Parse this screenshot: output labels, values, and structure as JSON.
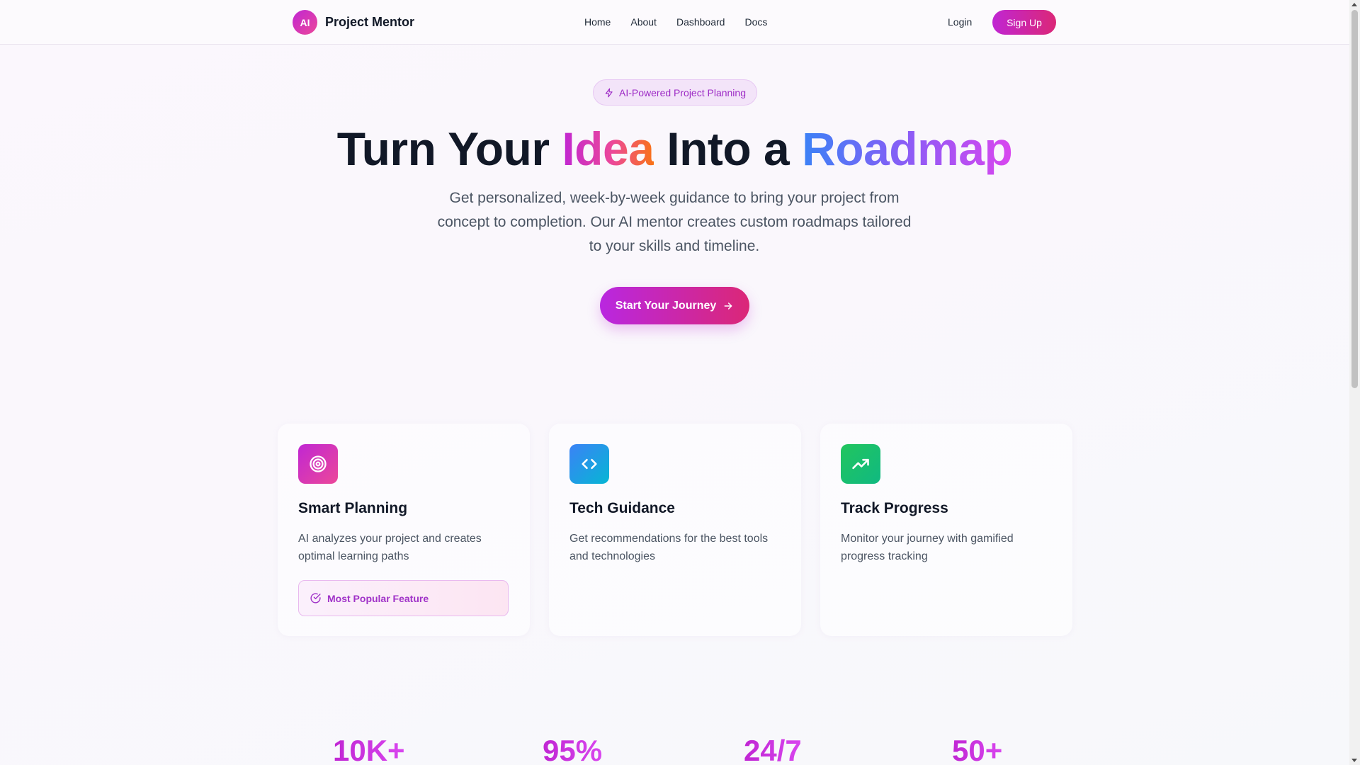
{
  "brand": {
    "logo_text": "AI",
    "name": "Project Mentor"
  },
  "nav": {
    "items": [
      "Home",
      "About",
      "Dashboard",
      "Docs"
    ]
  },
  "auth": {
    "login": "Login",
    "signup": "Sign Up"
  },
  "hero": {
    "badge": "AI-Powered Project Planning",
    "title_part1": "Turn Your ",
    "title_idea": "Idea",
    "title_part2": " Into a ",
    "title_roadmap": "Roadmap",
    "subtitle": "Get personalized, week-by-week guidance to bring your project from concept to completion. Our AI mentor creates custom roadmaps tailored to your skills and timeline.",
    "cta": "Start Your Journey"
  },
  "features": [
    {
      "icon": "target-icon",
      "title": "Smart Planning",
      "description": "AI analyzes your project and creates optimal learning paths",
      "badge": "Most Popular Feature",
      "color": "#c026d3"
    },
    {
      "icon": "code-icon",
      "title": "Tech Guidance",
      "description": "Get recommendations for the best tools and technologies",
      "color": "#3b82f6"
    },
    {
      "icon": "trending-up-icon",
      "title": "Track Progress",
      "description": "Monitor your journey with gamified progress tracking",
      "color": "#16a34a"
    }
  ],
  "stats": [
    "10K+",
    "95%",
    "24/7",
    "50+"
  ]
}
